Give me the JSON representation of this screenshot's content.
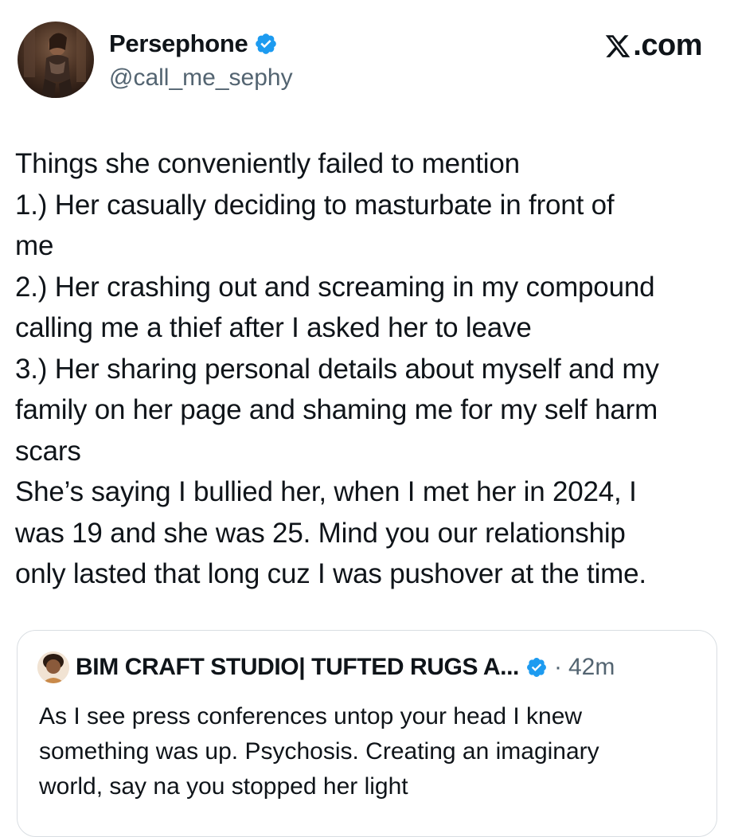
{
  "author": {
    "display_name": "Persephone",
    "handle": "@call_me_sephy",
    "verified": true
  },
  "brand": {
    "label": "X.com",
    "icon": "x-logo-icon"
  },
  "tweet": {
    "lines": [
      "Things she conveniently failed to mention",
      "1.) Her casually deciding to masturbate in front of",
      "me",
      "2.) Her crashing out and screaming in my compound",
      "calling me a thief after I asked her to leave",
      "3.) Her sharing personal details about myself and my",
      "family on her page and shaming me for my self harm",
      "scars",
      "She’s saying I bullied her, when I met her in 2024, I",
      "was 19 and she was 25. Mind you our relationship",
      "only lasted that long cuz I was pushover at the time."
    ]
  },
  "quoted_tweet": {
    "display_name": "BIM CRAFT STUDIO| TUFTED RUGS A...",
    "verified": true,
    "separator": "·",
    "time": "42m",
    "lines": [
      "As I see press conferences untop your head I knew",
      "something was up. Psychosis. Creating an imaginary",
      "world, say na you stopped her light"
    ]
  },
  "colors": {
    "verified_badge": "#1d9bf0",
    "secondary_text": "#536471",
    "primary_text": "#0f1419",
    "card_border": "#d9dee2"
  }
}
